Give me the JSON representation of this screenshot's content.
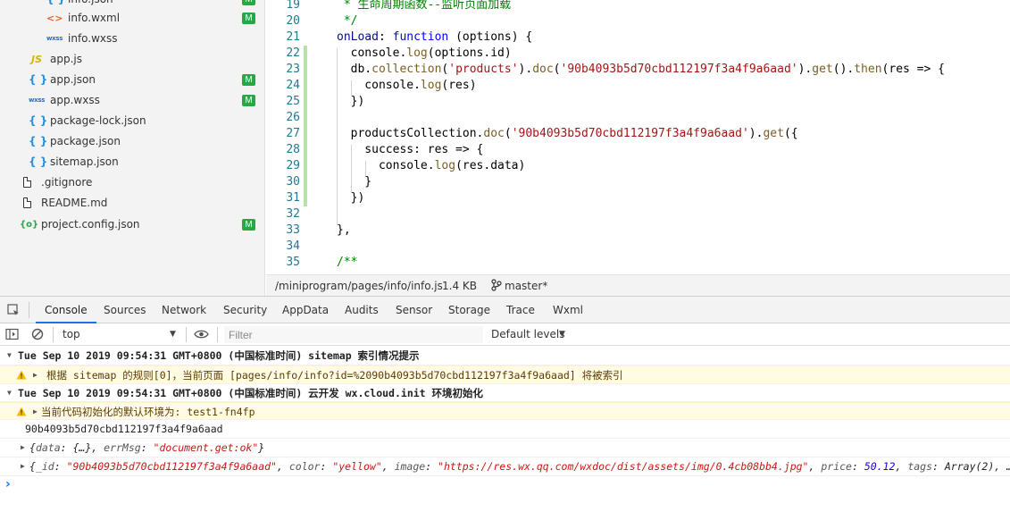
{
  "file_tree": {
    "items": [
      {
        "name": "info.json",
        "icon": "json-icon",
        "glyph": "{ }",
        "badge": "M"
      },
      {
        "name": "info.wxml",
        "icon": "wxml-icon",
        "glyph": "<>",
        "badge": "M"
      },
      {
        "name": "info.wxss",
        "icon": "wxss-icon",
        "glyph": "wxss",
        "badge": ""
      },
      {
        "name": "app.js",
        "icon": "js-icon",
        "glyph": "JS",
        "badge": ""
      },
      {
        "name": "app.json",
        "icon": "json-icon",
        "glyph": "{ }",
        "badge": "M"
      },
      {
        "name": "app.wxss",
        "icon": "wxss-icon",
        "glyph": "wxss",
        "badge": "M"
      },
      {
        "name": "package-lock.json",
        "icon": "json-icon",
        "glyph": "{ }",
        "badge": ""
      },
      {
        "name": "package.json",
        "icon": "json-icon",
        "glyph": "{ }",
        "badge": ""
      },
      {
        "name": "sitemap.json",
        "icon": "json-icon",
        "glyph": "{ }",
        "badge": ""
      },
      {
        "name": ".gitignore",
        "icon": "file-icon",
        "glyph": "",
        "badge": ""
      },
      {
        "name": "README.md",
        "icon": "file-icon",
        "glyph": "",
        "badge": ""
      },
      {
        "name": "project.config.json",
        "icon": "config-icon",
        "glyph": "{o}",
        "badge": "M"
      }
    ]
  },
  "editor": {
    "lines": [
      {
        "n": "19",
        "mod": false,
        "tokens": [
          [
            "cm",
            " * 生命周期函数--监听页面加载"
          ]
        ]
      },
      {
        "n": "20",
        "mod": false,
        "tokens": [
          [
            "cm",
            " */"
          ]
        ]
      },
      {
        "n": "21",
        "mod": false,
        "tokens": [
          [
            "pr",
            "onLoad"
          ],
          [
            "p",
            ": "
          ],
          [
            "kw",
            "function"
          ],
          [
            "p",
            " (options) {"
          ]
        ]
      },
      {
        "n": "22",
        "mod": true,
        "tokens": [
          [
            "p",
            "  console."
          ],
          [
            "fn",
            "log"
          ],
          [
            "p",
            "(options.id)"
          ]
        ]
      },
      {
        "n": "23",
        "mod": true,
        "tokens": [
          [
            "p",
            "  db."
          ],
          [
            "fn",
            "collection"
          ],
          [
            "p",
            "("
          ],
          [
            "str",
            "'products'"
          ],
          [
            "p",
            ")."
          ],
          [
            "fn",
            "doc"
          ],
          [
            "p",
            "("
          ],
          [
            "str",
            "'90b4093b5d70cbd112197f3a4f9a6aad'"
          ],
          [
            "p",
            ")."
          ],
          [
            "fn",
            "get"
          ],
          [
            "p",
            "()."
          ],
          [
            "fn",
            "then"
          ],
          [
            "p",
            "(res => {"
          ]
        ]
      },
      {
        "n": "24",
        "mod": true,
        "tokens": [
          [
            "p",
            "    console."
          ],
          [
            "fn",
            "log"
          ],
          [
            "p",
            "(res)"
          ]
        ]
      },
      {
        "n": "25",
        "mod": true,
        "tokens": [
          [
            "p",
            "  })"
          ]
        ]
      },
      {
        "n": "26",
        "mod": true,
        "tokens": [
          [
            "p",
            ""
          ]
        ]
      },
      {
        "n": "27",
        "mod": true,
        "tokens": [
          [
            "p",
            "  productsCollection."
          ],
          [
            "fn",
            "doc"
          ],
          [
            "p",
            "("
          ],
          [
            "str",
            "'90b4093b5d70cbd112197f3a4f9a6aad'"
          ],
          [
            "p",
            ")."
          ],
          [
            "fn",
            "get"
          ],
          [
            "p",
            "({"
          ]
        ]
      },
      {
        "n": "28",
        "mod": true,
        "tokens": [
          [
            "p",
            "    success: res => {"
          ]
        ]
      },
      {
        "n": "29",
        "mod": true,
        "tokens": [
          [
            "p",
            "      console."
          ],
          [
            "fn",
            "log"
          ],
          [
            "p",
            "(res.data)"
          ]
        ]
      },
      {
        "n": "30",
        "mod": true,
        "tokens": [
          [
            "p",
            "    }"
          ]
        ]
      },
      {
        "n": "31",
        "mod": true,
        "tokens": [
          [
            "p",
            "  })"
          ]
        ]
      },
      {
        "n": "32",
        "mod": false,
        "tokens": [
          [
            "p",
            ""
          ]
        ]
      },
      {
        "n": "33",
        "mod": false,
        "tokens": [
          [
            "p",
            "},"
          ]
        ]
      },
      {
        "n": "34",
        "mod": false,
        "tokens": [
          [
            "p",
            ""
          ]
        ]
      },
      {
        "n": "35",
        "mod": false,
        "tokens": [
          [
            "cm",
            "/**"
          ]
        ]
      }
    ]
  },
  "statusbar": {
    "path": "/miniprogram/pages/info/info.js",
    "size": "1.4 KB",
    "branch": "master*"
  },
  "devtools": {
    "tabs": [
      "Console",
      "Sources",
      "Network",
      "Security",
      "AppData",
      "Audits",
      "Sensor",
      "Storage",
      "Trace",
      "Wxml"
    ],
    "active_tab": "Console",
    "context": "top",
    "filter_placeholder": "Filter",
    "levels": "Default levels"
  },
  "console": {
    "group1": "Tue Sep 10 2019 09:54:31 GMT+0800 (中国标准时间) sitemap 索引情况提示",
    "warn1": "根据 sitemap 的规则[0]，当前页面 [pages/info/info?id=%2090b4093b5d70cbd112197f3a4f9a6aad] 将被索引",
    "group2": "Tue Sep 10 2019 09:54:31 GMT+0800 (中国标准时间) 云开发 wx.cloud.init 环境初始化",
    "warn2": "当前代码初始化的默认环境为: test1-fn4fp",
    "log_id": "90b4093b5d70cbd112197f3a4f9a6aad",
    "obj1": {
      "k1": "data",
      "v1": "{…}",
      "k2": "errMsg",
      "v2": "\"document.get:ok\""
    },
    "obj2": {
      "k1": "_id",
      "v1": "\"90b4093b5d70cbd112197f3a4f9a6aad\"",
      "k2": "color",
      "v2": "\"yellow\"",
      "k3": "image",
      "v3": "\"https://res.wx.qq.com/wxdoc/dist/assets/img/0.4cb08bb4.jpg\"",
      "k4": "price",
      "v4": "50.12",
      "k5": "tags",
      "v5": "Array(2)",
      "rest": ", …}"
    },
    "prompt": "›"
  },
  "colors": {
    "accent": "#1a73e8",
    "git_modified_badge": "#28a745",
    "warning_background": "#fffbe5"
  }
}
